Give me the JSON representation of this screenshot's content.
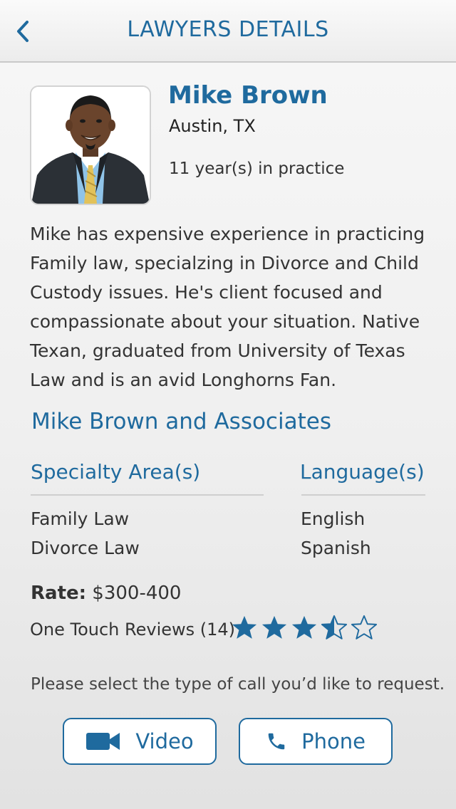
{
  "header": {
    "title": "LAWYERS DETAILS",
    "back_icon": "chevron-left-icon"
  },
  "profile": {
    "name": "Mike Brown",
    "location": "Austin, TX",
    "practice": "11 year(s) in practice",
    "photo_alt": "Mike Brown portrait"
  },
  "bio": "Mike has expensive experience in practicing Family law, specialzing in Divorce and Child Custody issues. He's client focused and compassionate about your situation. Native Texan, graduated from University of Texas Law and is an avid Longhorns Fan.",
  "firm": "Mike Brown and Associates",
  "specialty": {
    "heading": "Specialty Area(s)",
    "items": [
      "Family Law",
      "Divorce Law"
    ]
  },
  "languages": {
    "heading": "Language(s)",
    "items": [
      "English",
      "Spanish"
    ]
  },
  "rate": {
    "label": "Rate:",
    "value": "$300-400"
  },
  "reviews": {
    "label": "One Touch Reviews (14)",
    "rating": 3.5,
    "max": 5
  },
  "prompt": "Please select the type of call you’d like to request.",
  "buttons": {
    "video": {
      "label": "Video",
      "icon": "video-camera-icon"
    },
    "phone": {
      "label": "Phone",
      "icon": "phone-icon"
    }
  },
  "colors": {
    "accent": "#1f6a9e",
    "divider": "#cfcfcf"
  }
}
